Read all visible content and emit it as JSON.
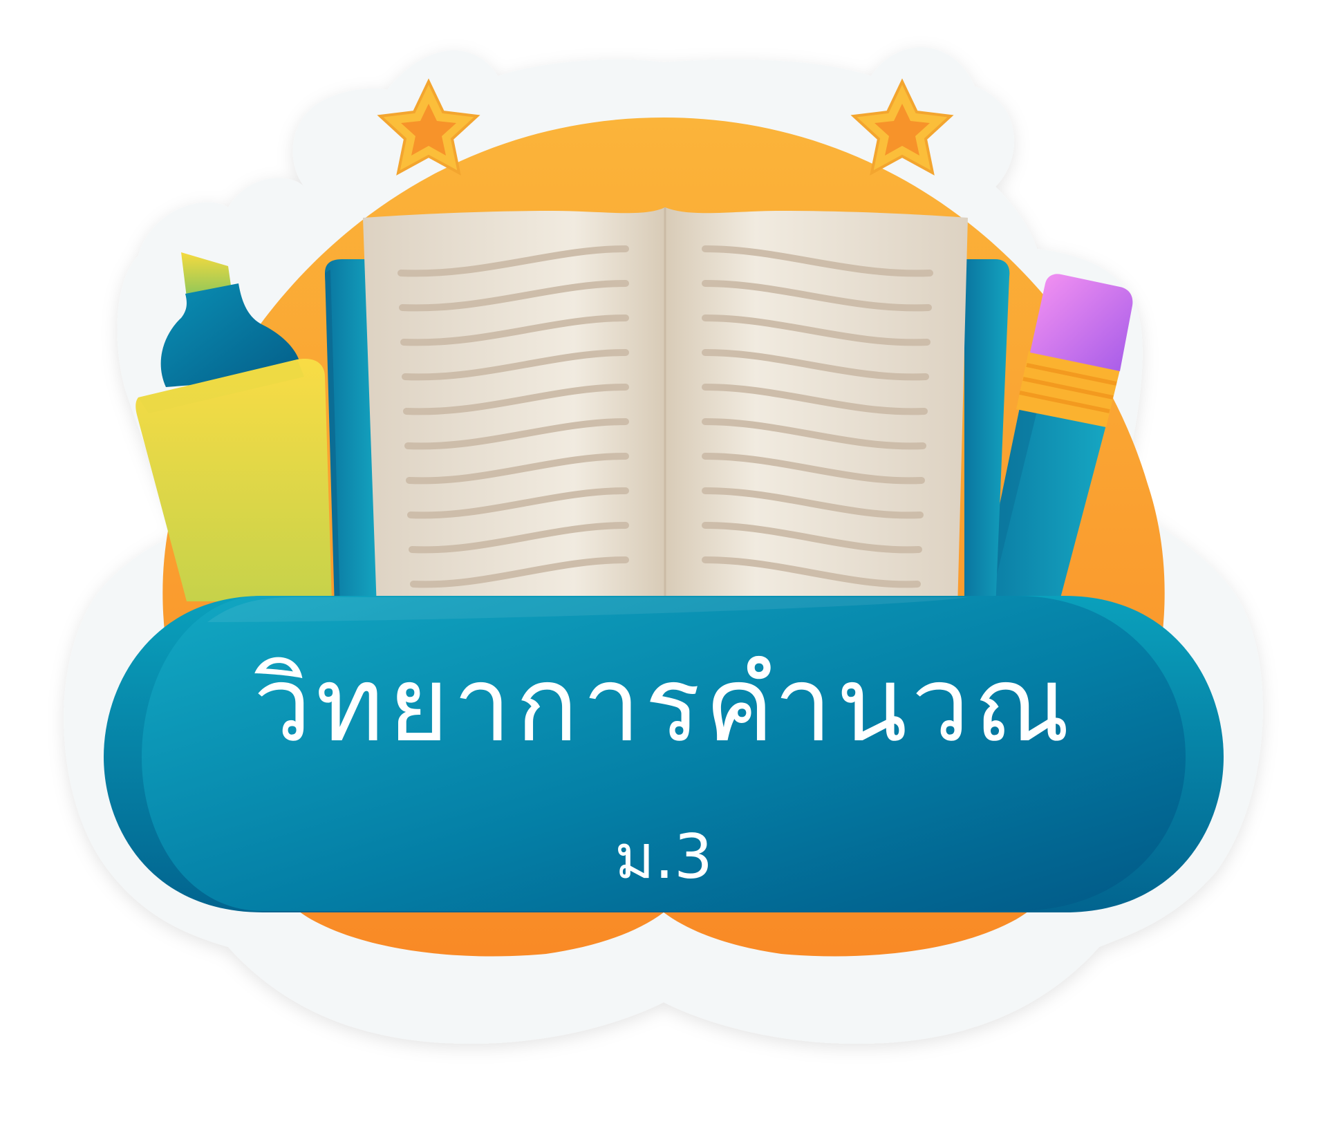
{
  "badge": {
    "title": "วิทยาการคำนวณ",
    "subtitle": "ม.3"
  },
  "icons": [
    "star-icon",
    "star-icon",
    "highlighter-icon",
    "open-book-icon",
    "pencil-icon"
  ],
  "colors": {
    "sticker_border": "#f4f7f8",
    "orange_blob_top": "#fbb43a",
    "orange_blob_bottom": "#f98a26",
    "banner_light": "#14a9c4",
    "banner_dark": "#005e8a",
    "book_cover": "#0f8fb0",
    "book_page": "#e9e1d3",
    "page_line": "#cdbdaa",
    "highlighter_body": "#f6d93f",
    "highlighter_cap": "#0a7ea6",
    "pencil_body": "#1196b4",
    "pencil_ferrule": "#fbb22f",
    "pencil_eraser": "#c47df0",
    "star_outer": "#fbbe3a",
    "star_inner": "#f7932a",
    "text": "#ffffff"
  }
}
